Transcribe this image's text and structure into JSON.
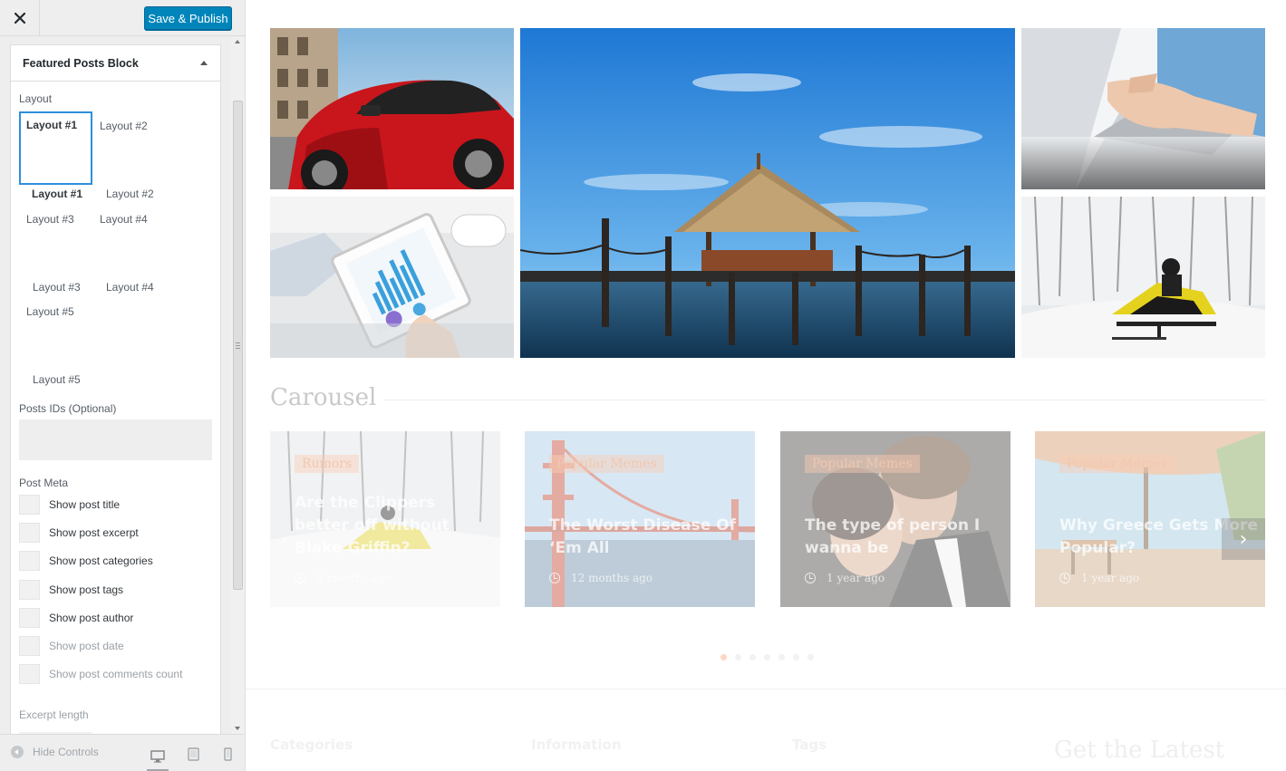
{
  "sidebar": {
    "publish_label": "Save & Publish",
    "section_title": "Featured Posts Block",
    "layout_label": "Layout",
    "layout_thumbs": [
      "Layout #1",
      "Layout #2",
      "Layout #3",
      "Layout #4",
      "Layout #5"
    ],
    "layout_names": [
      "Layout #1",
      "Layout #2",
      "Layout #3",
      "Layout #4",
      "Layout #5"
    ],
    "selected_layout": "Layout #1",
    "posts_ids_label": "Posts IDs (Optional)",
    "posts_ids_value": "",
    "post_meta_label": "Post Meta",
    "post_meta": [
      "Show post title",
      "Show post excerpt",
      "Show post categories",
      "Show post tags",
      "Show post author",
      "Show post date",
      "Show post comments count"
    ],
    "excerpt_length_label": "Excerpt length",
    "hide_controls_label": "Hide Controls"
  },
  "preview": {
    "carousel_heading": "Carousel",
    "cards": [
      {
        "tag": "Rumors",
        "title": "Are the Clippers better off without Blake Griffin?",
        "time": "2 months ago"
      },
      {
        "tag": "Popular Memes",
        "title": "The Worst Disease Of ‘Em All",
        "time": "12 months ago"
      },
      {
        "tag": "Popular Memes",
        "title": "The type of person I wanna be",
        "time": "1 year ago"
      },
      {
        "tag": "Popular Memes",
        "title": "Why Greece Gets More Popular?",
        "time": "1 year ago"
      }
    ],
    "footer": {
      "col1": "Categories",
      "col2": "Information",
      "col3": "Tags",
      "col4": "Get the Latest"
    }
  },
  "colors": {
    "accent": "#0085ba",
    "selected_border": "#2f8fdd",
    "tag_bg": "#facdb4"
  }
}
